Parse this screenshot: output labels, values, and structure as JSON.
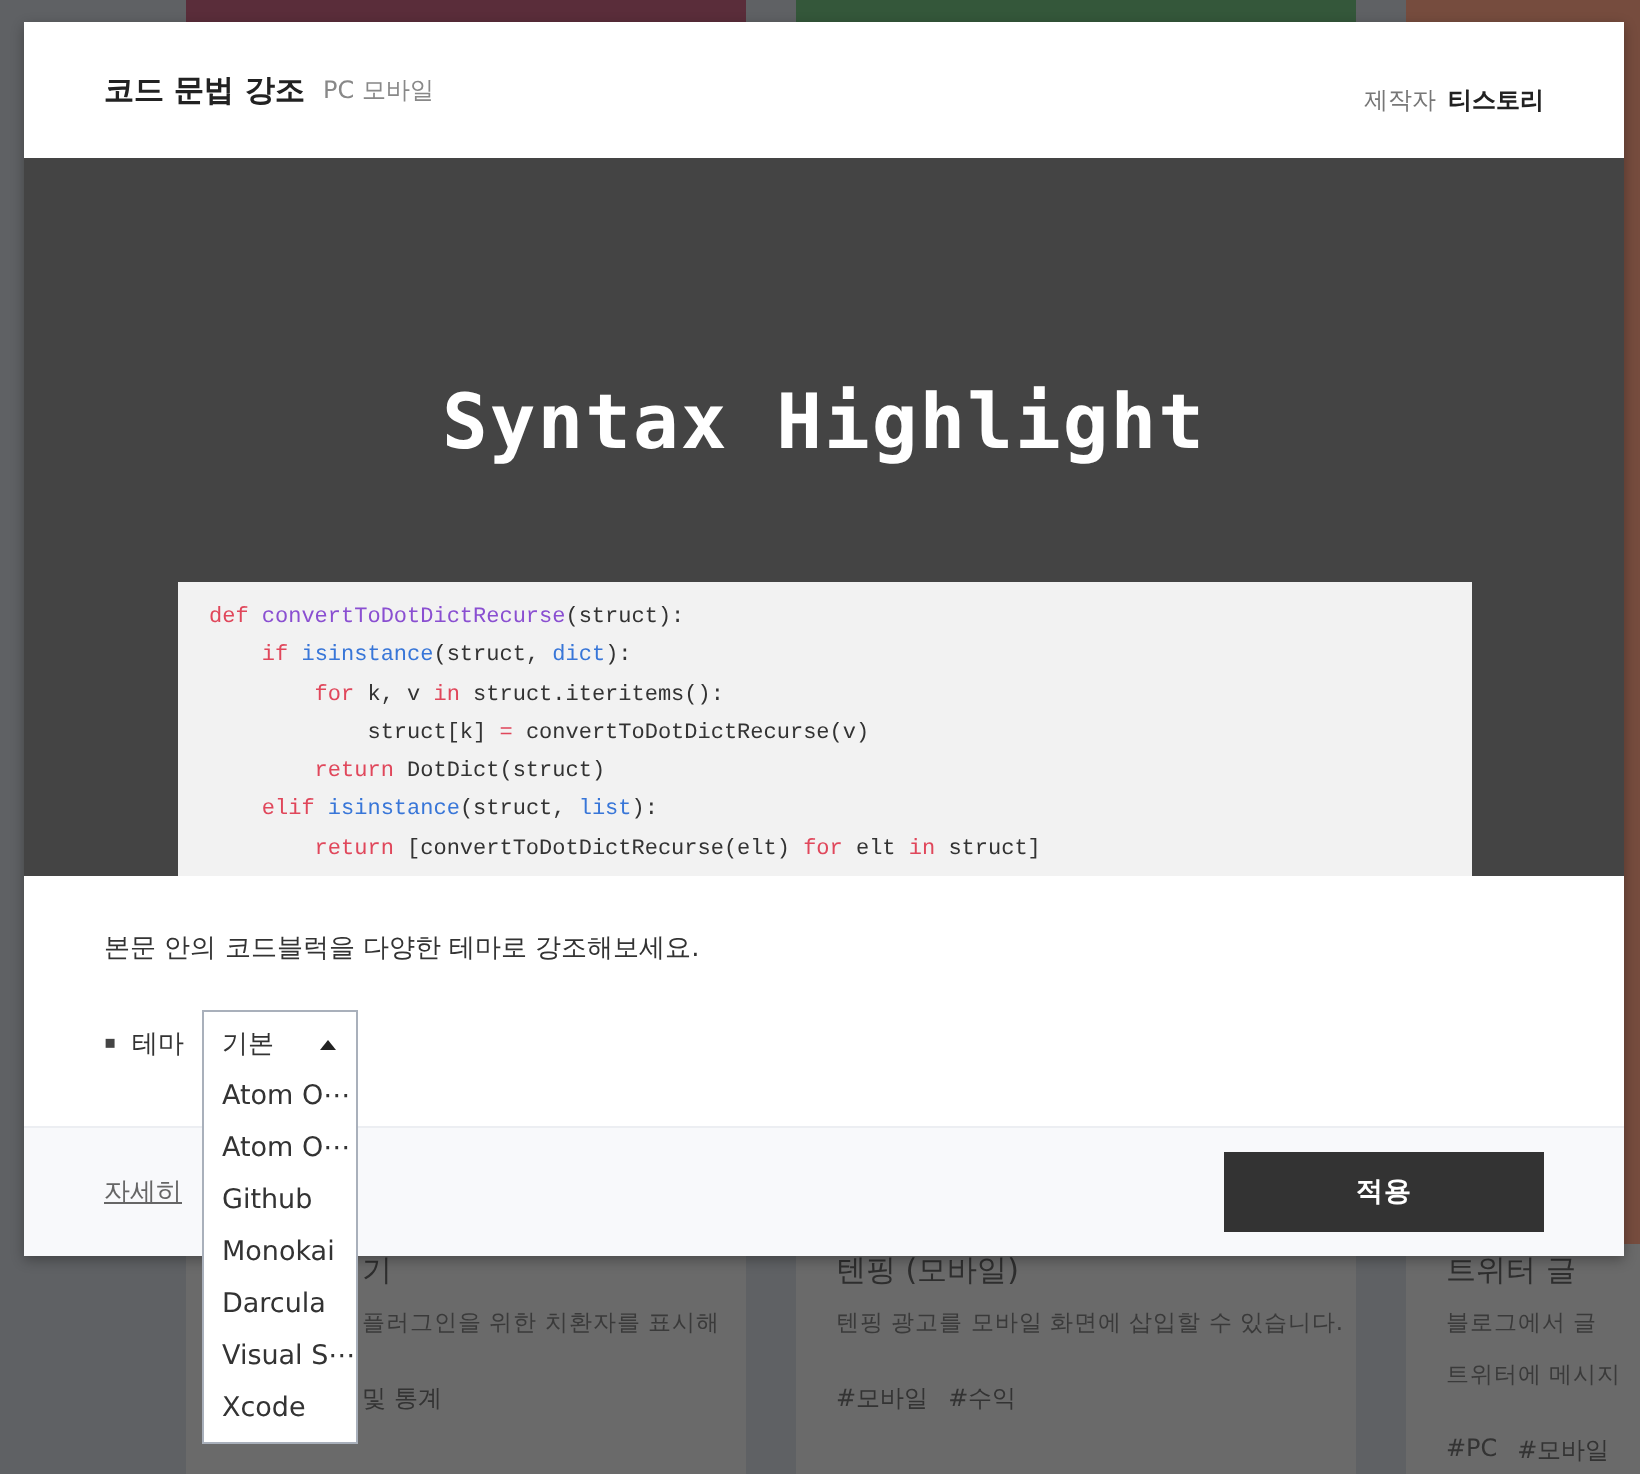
{
  "background_cards": [
    {
      "color": "#5a2d3a",
      "title": "기",
      "description": [
        "플러그인을 위한 치환자를 표시해"
      ],
      "tags": [
        "및 통계"
      ]
    },
    {
      "color": "#34573a",
      "title": "텐핑 (모바일)",
      "description": [
        "텐핑 광고를 모바일 화면에 삽입할 수 있습니다."
      ],
      "tags": [
        "#모바일",
        "#수익"
      ]
    },
    {
      "color": "#764c3e",
      "title": "트위터 글",
      "description": [
        "블로그에서 글",
        "트위터에 메시지"
      ],
      "tags": [
        "#PC",
        "#모바일"
      ]
    }
  ],
  "modal": {
    "title": "코드 문법 강조",
    "platforms": "PC 모바일",
    "maker_label": "제작자",
    "maker": "티스토리",
    "preview": {
      "heading": "Syntax Highlight",
      "code": [
        [
          {
            "t": "def ",
            "kind": "keyword"
          },
          {
            "t": "convertToDotDictRecurse",
            "kind": "function"
          },
          {
            "t": "(struct):",
            "kind": "plain"
          }
        ],
        [
          {
            "t": "    if ",
            "kind": "keyword"
          },
          {
            "t": "isinstance",
            "kind": "builtin"
          },
          {
            "t": "(struct, ",
            "kind": "plain"
          },
          {
            "t": "dict",
            "kind": "builtin"
          },
          {
            "t": "):",
            "kind": "plain"
          }
        ],
        [
          {
            "t": "        for",
            "kind": "keyword"
          },
          {
            "t": " k, v ",
            "kind": "plain"
          },
          {
            "t": "in",
            "kind": "keyword"
          },
          {
            "t": " struct.iteritems():",
            "kind": "plain"
          }
        ],
        [
          {
            "t": "            struct[k] ",
            "kind": "plain"
          },
          {
            "t": "=",
            "kind": "keyword"
          },
          {
            "t": " convertToDotDictRecurse(v)",
            "kind": "plain"
          }
        ],
        [
          {
            "t": "        return",
            "kind": "keyword"
          },
          {
            "t": " DotDict(struct)",
            "kind": "plain"
          }
        ],
        [
          {
            "t": "    elif ",
            "kind": "keyword"
          },
          {
            "t": "isinstance",
            "kind": "builtin"
          },
          {
            "t": "(struct, ",
            "kind": "plain"
          },
          {
            "t": "list",
            "kind": "builtin"
          },
          {
            "t": "):",
            "kind": "plain"
          }
        ],
        [
          {
            "t": "        return",
            "kind": "keyword"
          },
          {
            "t": " [convertToDotDictRecurse(elt) ",
            "kind": "plain"
          },
          {
            "t": "for",
            "kind": "keyword"
          },
          {
            "t": " elt ",
            "kind": "plain"
          },
          {
            "t": "in",
            "kind": "keyword"
          },
          {
            "t": " struct]",
            "kind": "plain"
          }
        ]
      ]
    },
    "description": "본문 안의 코드블럭을 다양한 테마로 강조해보세요.",
    "setting": {
      "bullet": "▪",
      "label": "테마",
      "value": "기본",
      "expanded": true,
      "options": [
        "Atom O⋯",
        "Atom O⋯",
        "Github",
        "Monokai",
        "Darcula",
        "Visual S⋯",
        "Xcode"
      ]
    },
    "more_link": "자세히",
    "apply_button": "적용"
  }
}
